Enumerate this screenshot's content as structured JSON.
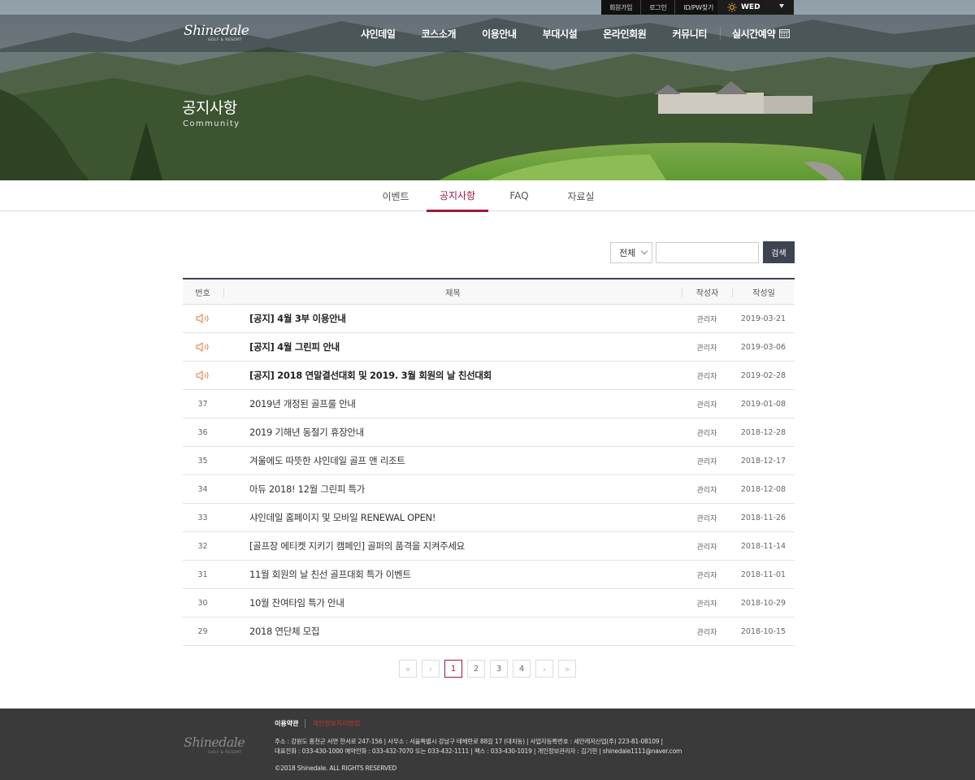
{
  "header": {
    "util_links": [
      "회원가입",
      "로그인",
      "ID/PW찾기"
    ],
    "weather_day": "WED",
    "logo_text": "Shinedale",
    "logo_sub": "GOLF & RESORT",
    "menu": [
      "샤인데일",
      "코스소개",
      "이용안내",
      "부대시설",
      "온라인회원",
      "커뮤니티"
    ],
    "reserve_label": "실시간예약"
  },
  "hero": {
    "title": "공지사항",
    "subtitle": "Community"
  },
  "tabs": [
    "이벤트",
    "공지사항",
    "FAQ",
    "자료실"
  ],
  "active_tab": 1,
  "search": {
    "select_value": "전체",
    "input_value": "",
    "button_label": "검색"
  },
  "board": {
    "columns": [
      "번호",
      "제목",
      "작성자",
      "작성일"
    ],
    "rows": [
      {
        "num": "",
        "notice": true,
        "title": "[공지] 4월 3부 이용안내",
        "author": "관리자",
        "date": "2019-03-21"
      },
      {
        "num": "",
        "notice": true,
        "title": "[공지] 4월 그린피 안내",
        "author": "관리자",
        "date": "2019-03-06"
      },
      {
        "num": "",
        "notice": true,
        "title": "[공지] 2018 연말결선대회 및 2019. 3월 회원의 날 친선대회",
        "author": "관리자",
        "date": "2019-02-28"
      },
      {
        "num": "37",
        "notice": false,
        "title": "2019년 개정된 골프룰 안내",
        "author": "관리자",
        "date": "2019-01-08"
      },
      {
        "num": "36",
        "notice": false,
        "title": "2019 기해년 동절기 휴장안내",
        "author": "관리자",
        "date": "2018-12-28"
      },
      {
        "num": "35",
        "notice": false,
        "title": "겨울에도 따뜻한 샤인데일 골프 앤 리조트",
        "author": "관리자",
        "date": "2018-12-17"
      },
      {
        "num": "34",
        "notice": false,
        "title": "아듀 2018! 12월 그린피 특가",
        "author": "관리자",
        "date": "2018-12-08"
      },
      {
        "num": "33",
        "notice": false,
        "title": "샤인데일 홈페이지 및 모바일 RENEWAL OPEN!",
        "author": "관리자",
        "date": "2018-11-26"
      },
      {
        "num": "32",
        "notice": false,
        "title": "[골프장 에티켓 지키기 캠페인] 골퍼의 품격을 지켜주세요",
        "author": "관리자",
        "date": "2018-11-14"
      },
      {
        "num": "31",
        "notice": false,
        "title": "11월 회원의 날 친선 골프대회 특가 이벤트",
        "author": "관리자",
        "date": "2018-11-01"
      },
      {
        "num": "30",
        "notice": false,
        "title": "10월 잔여타임 특가 안내",
        "author": "관리자",
        "date": "2018-10-29"
      },
      {
        "num": "29",
        "notice": false,
        "title": "2018 연단체 모집",
        "author": "관리자",
        "date": "2018-10-15"
      }
    ]
  },
  "pagination": {
    "first": "«",
    "prev": "‹",
    "pages": [
      "1",
      "2",
      "3",
      "4"
    ],
    "current": "1",
    "next": "›",
    "last": "»"
  },
  "footer": {
    "links": [
      "이용약관",
      "개인정보처리방침"
    ],
    "address_line": "주소 : 강원도 홍천군 서면 한서로 247-156  |  사무소 : 서울특별시 강남구 테헤란로 88길 17 (대치동)  |  사업자등록번호 : 세안레저산업(주) 223-81-08109  |",
    "contact_line": "대표전화 : 033-430-1000 예약전화 : 033-432-7070 또는 033-432-1111  |  팩스 : 033-430-1019  |  개인정보관리자 : 김기현  |  shinedale1111@naver.com",
    "copyright": "©2018 Shinedale. ALL RIGHTS RESERVED"
  },
  "colors": {
    "accent": "#9e1a3a",
    "dark_button": "#3b4450",
    "footer_bg": "#3a3a3a",
    "notice_icon": "#e07a3a"
  }
}
